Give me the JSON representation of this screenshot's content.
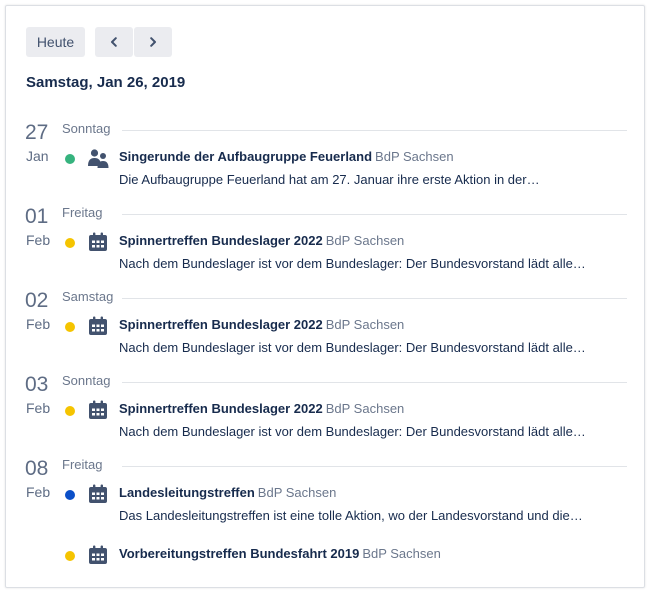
{
  "toolbar": {
    "today_label": "Heute",
    "prev_icon": "chevron-left-icon",
    "next_icon": "chevron-right-icon"
  },
  "current_date": "Samstag, Jan 26, 2019",
  "colors": {
    "green": "#36b37e",
    "yellow": "#f5c400",
    "blue": "#0b4fc8",
    "icon": "#42526e"
  },
  "days": [
    {
      "num": "27",
      "month": "Jan",
      "weekday": "Sonntag",
      "events": [
        {
          "title": "Singerunde der Aufbaugruppe Feuerland",
          "org": "BdP Sachsen",
          "desc": "Die Aufbaugruppe Feuerland hat am 27. Januar ihre erste Aktion in der…",
          "dot": "#36b37e",
          "icon": "group-icon"
        }
      ]
    },
    {
      "num": "01",
      "month": "Feb",
      "weekday": "Freitag",
      "events": [
        {
          "title": "Spinnertreffen Bundeslager 2022",
          "org": "BdP Sachsen",
          "desc": "Nach dem Bundeslager ist vor dem Bundeslager: Der Bundesvorstand lädt alle…",
          "dot": "#f5c400",
          "icon": "calendar-icon"
        }
      ]
    },
    {
      "num": "02",
      "month": "Feb",
      "weekday": "Samstag",
      "events": [
        {
          "title": "Spinnertreffen Bundeslager 2022",
          "org": "BdP Sachsen",
          "desc": "Nach dem Bundeslager ist vor dem Bundeslager: Der Bundesvorstand lädt alle…",
          "dot": "#f5c400",
          "icon": "calendar-icon"
        }
      ]
    },
    {
      "num": "03",
      "month": "Feb",
      "weekday": "Sonntag",
      "events": [
        {
          "title": "Spinnertreffen Bundeslager 2022",
          "org": "BdP Sachsen",
          "desc": "Nach dem Bundeslager ist vor dem Bundeslager: Der Bundesvorstand lädt alle…",
          "dot": "#f5c400",
          "icon": "calendar-icon"
        }
      ]
    },
    {
      "num": "08",
      "month": "Feb",
      "weekday": "Freitag",
      "events": [
        {
          "title": "Landesleitungstreffen",
          "org": "BdP Sachsen",
          "desc": "Das Landesleitungstreffen ist eine tolle Aktion, wo der Landesvorstand und die…",
          "dot": "#0b4fc8",
          "icon": "calendar-icon"
        },
        {
          "title": "Vorbereitungstreffen Bundesfahrt 2019",
          "org": "BdP Sachsen",
          "desc": "",
          "dot": "#f5c400",
          "icon": "calendar-icon"
        }
      ]
    }
  ]
}
